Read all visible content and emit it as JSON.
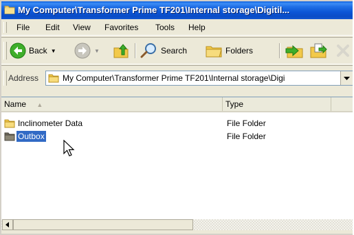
{
  "window": {
    "title": "My Computer\\Transformer Prime TF201\\Internal storage\\Digitil..."
  },
  "menu": {
    "items": [
      "File",
      "Edit",
      "View",
      "Favorites",
      "Tools",
      "Help"
    ]
  },
  "toolbar": {
    "back_label": "Back",
    "search_label": "Search",
    "folders_label": "Folders"
  },
  "address": {
    "label": "Address",
    "value": "My Computer\\Transformer Prime TF201\\Internal storage\\Digi"
  },
  "list": {
    "columns": [
      "Name",
      "Type"
    ],
    "rows": [
      {
        "name": "Inclinometer Data",
        "type": "File Folder",
        "selected": false
      },
      {
        "name": "Outbox",
        "type": "File Folder",
        "selected": true
      }
    ]
  },
  "colors": {
    "titlebar": "#0a5fe0",
    "selection": "#316ac5",
    "chrome": "#ece9d8"
  }
}
